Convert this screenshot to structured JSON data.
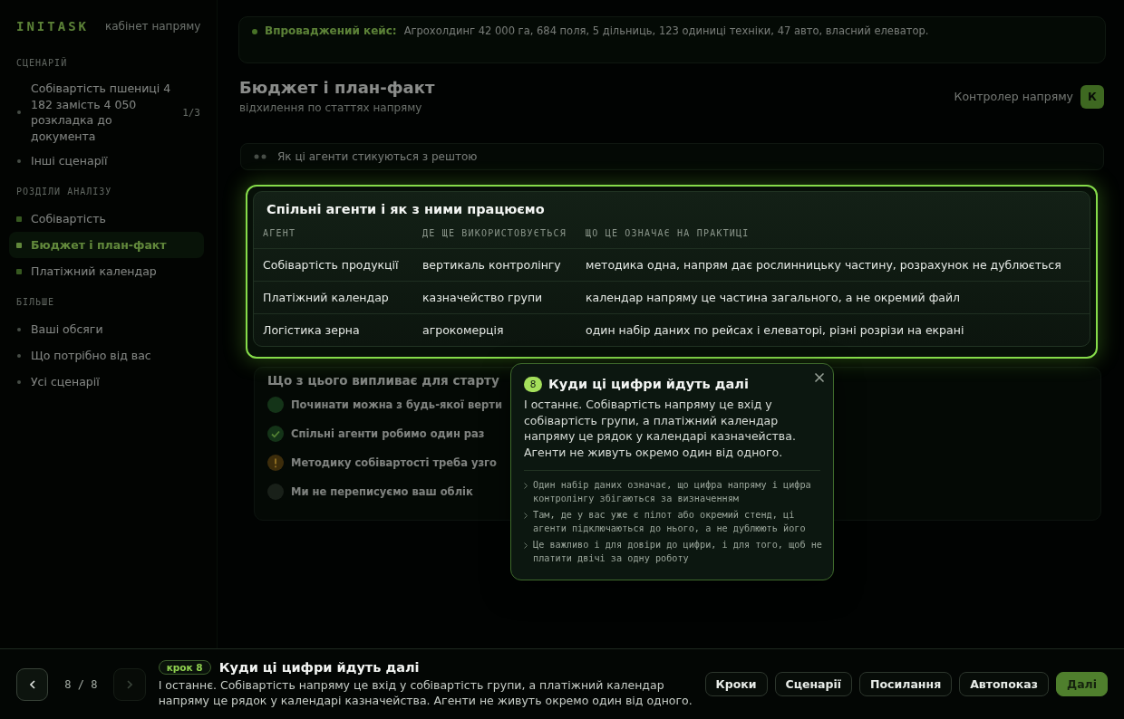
{
  "sidebar": {
    "logo": "INITASK",
    "subtitle": "кабінет напряму",
    "groups": [
      {
        "title": "СЦЕНАРІЙ",
        "kind": "links",
        "items": [
          {
            "label": "Собівартість пшениці 4 182 замість 4 050 розкладка до документа",
            "count": "1/3",
            "selected": false
          },
          {
            "label": "Інші сценарії",
            "selected": false
          }
        ]
      },
      {
        "title": "РОЗДІЛИ АНАЛІЗУ",
        "kind": "sections",
        "items": [
          {
            "label": "Собівартість",
            "selected": false
          },
          {
            "label": "Бюджет і план-факт",
            "selected": true
          },
          {
            "label": "Платіжний календар",
            "selected": false
          }
        ]
      },
      {
        "title": "БІЛЬШЕ",
        "kind": "links",
        "items": [
          {
            "label": "Ваші обсяги",
            "selected": false
          },
          {
            "label": "Що потрібно від вас",
            "selected": false
          },
          {
            "label": "Усі сценарії",
            "selected": false
          }
        ]
      }
    ]
  },
  "main": {
    "banner": {
      "label": "Впроваджений кейс:",
      "text": "Агрохолдинг 42 000 га, 684 поля, 5 дільниць, 123 одиниці техніки, 47 авто, власний елеватор."
    },
    "header": {
      "title": "Бюджет і план-факт",
      "subtitle": "відхилення по статтях напряму",
      "role": "Контролер напряму",
      "initial": "К"
    },
    "section_bar": {
      "title": "Як ці агенти стикуються з рештою"
    },
    "agents_card": {
      "highlighted": true,
      "title": "Спільні агенти і як з ними працюємо",
      "columns": [
        "АГЕНТ",
        "ДЕ ЩЕ ВИКОРИСТОВУЄТЬСЯ",
        "ЩО ЦЕ ОЗНАЧАЄ НА ПРАКТИЦІ"
      ],
      "rows": [
        [
          "Собівартість продукції",
          "вертикаль контролінгу",
          "методика одна, напрям дає рослинницьку частину, розрахунок не дублюється"
        ],
        [
          "Платіжний календар",
          "казначейство групи",
          "календар напряму це частина загального, а не окремий файл"
        ],
        [
          "Логістика зерна",
          "агрокомерція",
          "один набір даних по рейсах і елеваторі, різні розрізи на екрані"
        ]
      ]
    },
    "start_section": {
      "title": "Що з цього випливає для старту",
      "items": [
        {
          "kind": "start",
          "text": "Починати можна з будь-якої верти"
        },
        {
          "kind": "check",
          "text": "Спільні агенти робимо один раз"
        },
        {
          "kind": "warn",
          "text": "Методику собівартості треба узго"
        },
        {
          "kind": "note",
          "text": "Ми не переписуємо ваш облік"
        }
      ]
    }
  },
  "tooltip": {
    "step": "8",
    "title": "Куди ці цифри йдуть далі",
    "text": "І останнє. Собівартість напряму це вхід у собівартість групи, а платіжний календар напряму це рядок у календарі казначейства. Агенти не живуть окремо один від одного.",
    "notes": [
      "Один набір даних означає, що цифра напряму і цифра контролінгу збігаються за визначенням",
      "Там, де у вас уже є пілот або окремий стенд, ці агенти підключаються до нього, а не дублюють його",
      "Це важливо і для довіри до цифри, і для того, щоб не платити двічі за одну роботу"
    ]
  },
  "tour_bar": {
    "prev": {
      "disabled": false
    },
    "counter": "8 / 8",
    "next": {
      "disabled": true
    },
    "step_label": "крок 8",
    "title": "Куди ці цифри йдуть далі",
    "text": "І останнє. Собівартість напряму це вхід у собівартість групи, а платіжний календар напряму це рядок у календарі казначейства. Агенти не живуть окремо один від одного.",
    "buttons": [
      {
        "label": "Кроки",
        "primary": false
      },
      {
        "label": "Сценарії",
        "primary": false
      },
      {
        "label": "Посилання",
        "primary": false
      },
      {
        "label": "Автопоказ",
        "primary": false
      },
      {
        "label": "Далі",
        "primary": true
      }
    ]
  }
}
